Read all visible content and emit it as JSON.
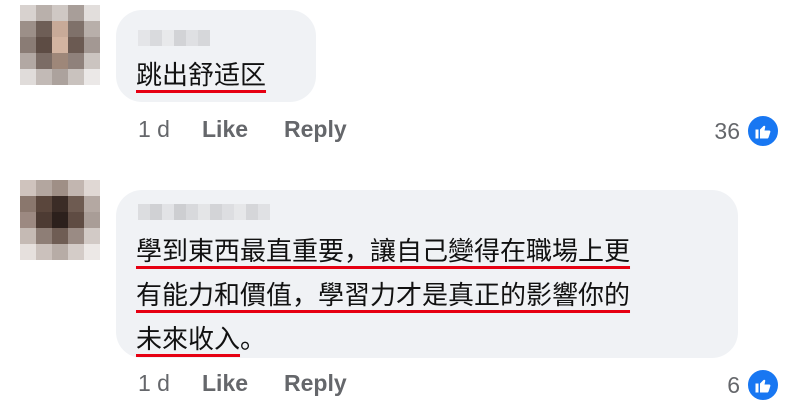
{
  "comments": [
    {
      "text_lines": [
        "跳出舒适区"
      ],
      "age": "1 d",
      "like_label": "Like",
      "reply_label": "Reply",
      "reaction_count": "36"
    },
    {
      "text_lines": [
        "學到東西最直重要，讓自己變得在職場上更",
        "有能力和價值，學習力才是真正的影響你的",
        "未來收入",
        "。"
      ],
      "age": "1 d",
      "like_label": "Like",
      "reply_label": "Reply",
      "reaction_count": "6"
    }
  ],
  "colors": {
    "bubble_bg": "#f0f2f5",
    "underline": "#e60012",
    "meta_text": "#65676b",
    "like_blue": "#1877f2"
  },
  "icons": {
    "reaction": "thumbs-up-icon",
    "avatar": "pixelated-avatar"
  }
}
